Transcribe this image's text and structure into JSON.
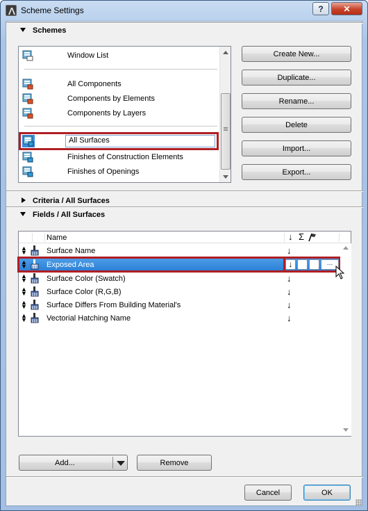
{
  "window": {
    "title": "Scheme Settings",
    "help_label": "?",
    "close_label": "✕"
  },
  "schemes": {
    "header": "Schemes",
    "items": [
      {
        "label": "Window List"
      },
      {
        "label": "All Components"
      },
      {
        "label": "Components by Elements"
      },
      {
        "label": "Components by Layers"
      },
      {
        "label": "All Surfaces",
        "selected": true
      },
      {
        "label": "Finishes of Construction Elements"
      },
      {
        "label": "Finishes of Openings"
      }
    ],
    "buttons": {
      "create_new": "Create New...",
      "duplicate": "Duplicate...",
      "rename": "Rename...",
      "delete": "Delete",
      "import": "Import...",
      "export": "Export..."
    }
  },
  "criteria": {
    "header_prefix": "Criteria /",
    "header_name": "All Surfaces"
  },
  "fields": {
    "header_prefix": "Fields /",
    "header_name": "All Surfaces",
    "column_name": "Name",
    "column_sort_icon": "sort-arrow-icon",
    "column_sum_icon": "sum-icon",
    "column_flag_icon": "flag-icon",
    "rows": [
      {
        "label": "Surface Name",
        "sort": "↓"
      },
      {
        "label": "Exposed Area",
        "sort": "↓",
        "selected": true,
        "more_label": "..."
      },
      {
        "label": "Surface Color (Swatch)",
        "sort": "↓"
      },
      {
        "label": "Surface Color (R,G,B)",
        "sort": "↓"
      },
      {
        "label": "Surface Differs From Building Material's",
        "sort": "↓"
      },
      {
        "label": "Vectorial Hatching Name",
        "sort": "↓"
      }
    ],
    "add_label": "Add...",
    "remove_label": "Remove"
  },
  "footer": {
    "cancel_label": "Cancel",
    "ok_label": "OK"
  },
  "colors": {
    "selection_highlight": "#b01e23",
    "selected_row_bg": "#3a8de0"
  }
}
